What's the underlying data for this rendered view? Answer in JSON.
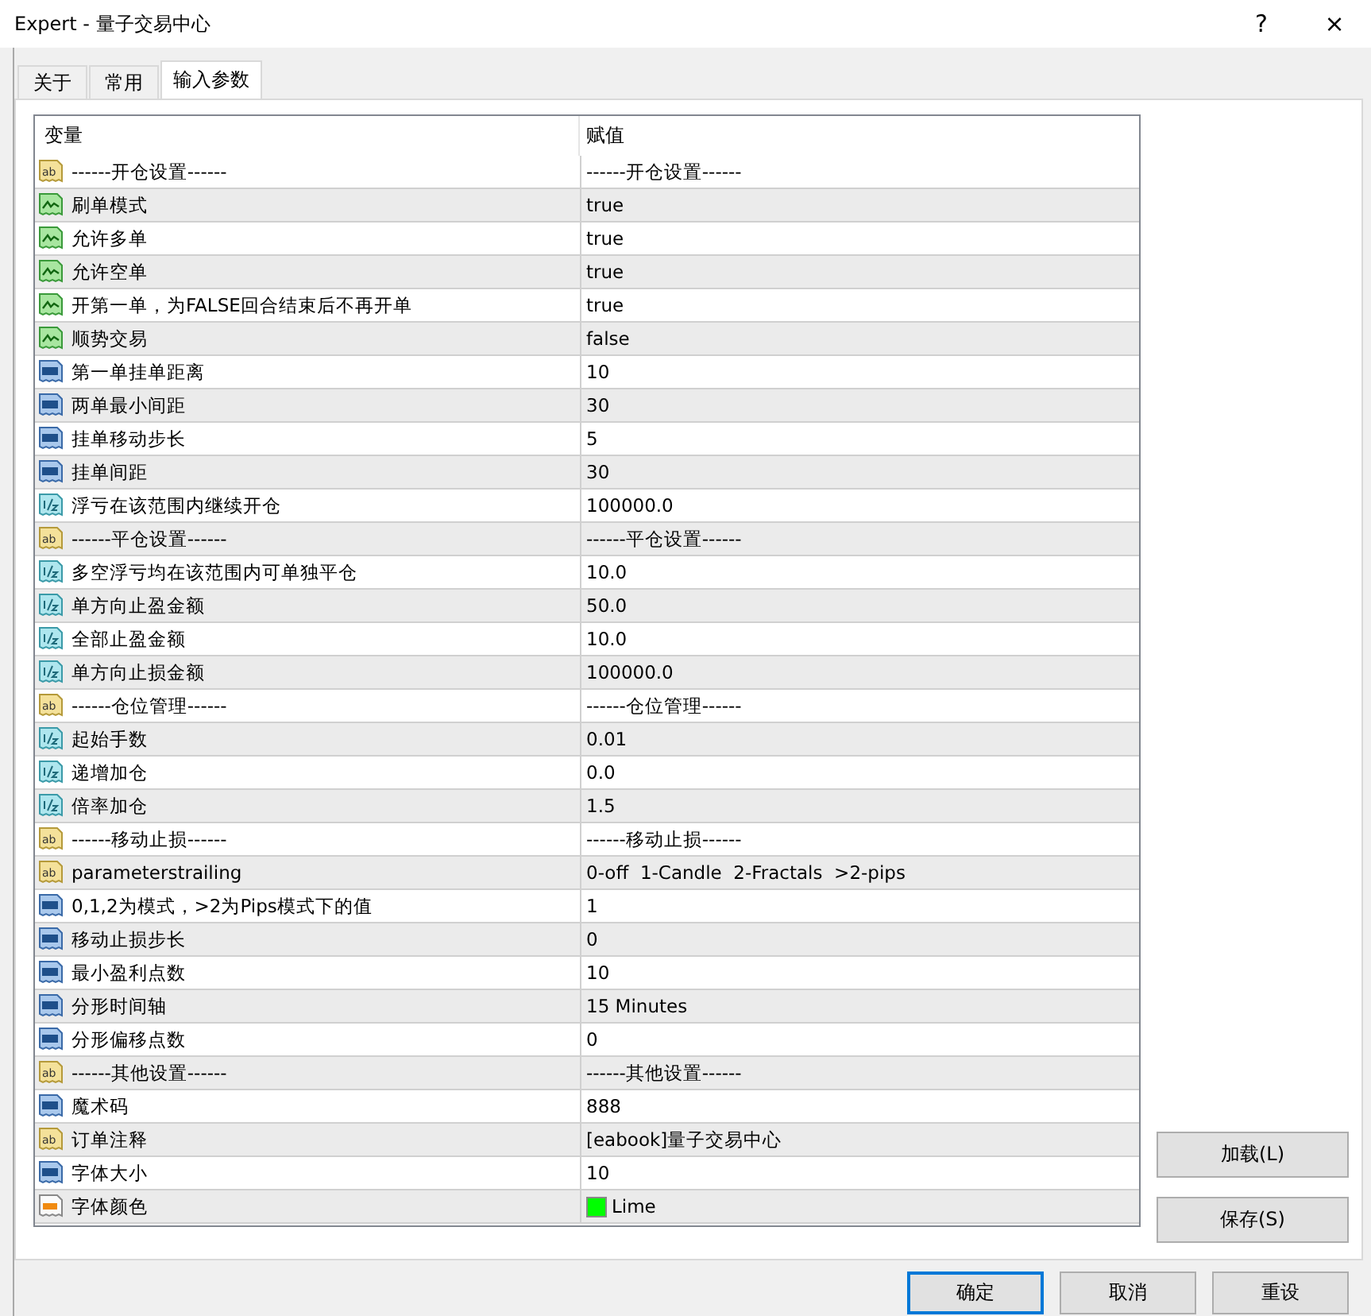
{
  "window": {
    "title": "Expert - 量子交易中心",
    "help": "?",
    "close": "×"
  },
  "tabs": [
    {
      "label": "关于",
      "selected": false
    },
    {
      "label": "常用",
      "selected": false
    },
    {
      "label": "输入参数",
      "selected": true
    }
  ],
  "table": {
    "columns": [
      "变量",
      "赋值"
    ],
    "rows": [
      {
        "kind": "text",
        "icon_text": "ab",
        "name": "------开仓设置------",
        "value": "------开仓设置------"
      },
      {
        "kind": "bool",
        "name": "刷单模式",
        "value": "true"
      },
      {
        "kind": "bool",
        "name": "允许多单",
        "value": "true"
      },
      {
        "kind": "bool",
        "name": "允许空单",
        "value": "true"
      },
      {
        "kind": "bool",
        "name": "开第一单，为FALSE回合结束后不再开单",
        "value": "true"
      },
      {
        "kind": "bool",
        "name": "顺势交易",
        "value": "false"
      },
      {
        "kind": "int",
        "name": "第一单挂单距离",
        "value": "10"
      },
      {
        "kind": "int",
        "name": "两单最小间距",
        "value": "30"
      },
      {
        "kind": "int",
        "name": "挂单移动步长",
        "value": "5"
      },
      {
        "kind": "int",
        "name": "挂单间距",
        "value": "30"
      },
      {
        "kind": "double",
        "name": "浮亏在该范围内继续开仓",
        "value": "100000.0"
      },
      {
        "kind": "text",
        "icon_text": "ab",
        "name": "------平仓设置------",
        "value": "------平仓设置------"
      },
      {
        "kind": "double",
        "name": "多空浮亏均在该范围内可单独平仓",
        "value": "10.0"
      },
      {
        "kind": "double",
        "name": "单方向止盈金额",
        "value": "50.0"
      },
      {
        "kind": "double",
        "name": "全部止盈金额",
        "value": "10.0"
      },
      {
        "kind": "double",
        "name": "单方向止损金额",
        "value": "100000.0"
      },
      {
        "kind": "text",
        "icon_text": "ab",
        "name": "------仓位管理------",
        "value": "------仓位管理------"
      },
      {
        "kind": "double",
        "name": "起始手数",
        "value": "0.01"
      },
      {
        "kind": "double",
        "name": "递增加仓",
        "value": "0.0"
      },
      {
        "kind": "double",
        "name": "倍率加仓",
        "value": "1.5"
      },
      {
        "kind": "text",
        "icon_text": "ab",
        "name": "------移动止损------",
        "value": "------移动止损------"
      },
      {
        "kind": "text",
        "icon_text": "ab",
        "name": "parameterstrailing",
        "value": "0-off  1-Candle  2-Fractals  >2-pips"
      },
      {
        "kind": "int",
        "name": "0,1,2为模式，>2为Pips模式下的值",
        "value": "1"
      },
      {
        "kind": "int",
        "name": "移动止损步长",
        "value": "0"
      },
      {
        "kind": "int",
        "name": "最小盈利点数",
        "value": "10"
      },
      {
        "kind": "int",
        "name": "分形时间轴",
        "value": "15 Minutes"
      },
      {
        "kind": "int",
        "name": "分形偏移点数",
        "value": "0"
      },
      {
        "kind": "text",
        "icon_text": "ab",
        "name": "------其他设置------",
        "value": "------其他设置------"
      },
      {
        "kind": "int",
        "name": "魔术码",
        "value": "888"
      },
      {
        "kind": "text",
        "icon_text": "ab",
        "name": "订单注释",
        "value": "[eabook]量子交易中心"
      },
      {
        "kind": "int",
        "name": "字体大小",
        "value": "10"
      },
      {
        "kind": "color",
        "name": "字体颜色",
        "value": "Lime",
        "color": "#00ff00"
      }
    ]
  },
  "side_buttons": [
    "加载(L)",
    "保存(S)"
  ],
  "buttons": [
    {
      "label": "确定",
      "selected": true
    },
    {
      "label": "取消",
      "selected": false
    },
    {
      "label": "重设",
      "selected": false
    }
  ]
}
